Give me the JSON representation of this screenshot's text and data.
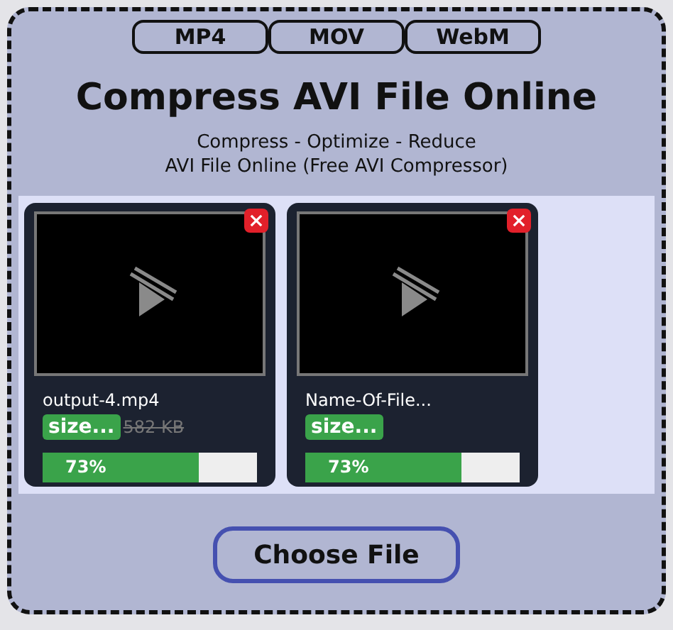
{
  "formats": [
    "MP4",
    "MOV",
    "WebM"
  ],
  "title": "Compress AVI File Online",
  "subtitle_lines": [
    "Compress - Optimize - Reduce",
    "AVI File Online (Free AVI Compressor)"
  ],
  "files": [
    {
      "name": "output-4.mp4",
      "size_label": "size...",
      "original_size": "582 KB",
      "level": 0.73,
      "progress": "73%"
    },
    {
      "name": "Name-Of-File...",
      "size_label": "size...",
      "level": 0.73,
      "progress": "73%"
    }
  ],
  "choose_button": "Choose File"
}
